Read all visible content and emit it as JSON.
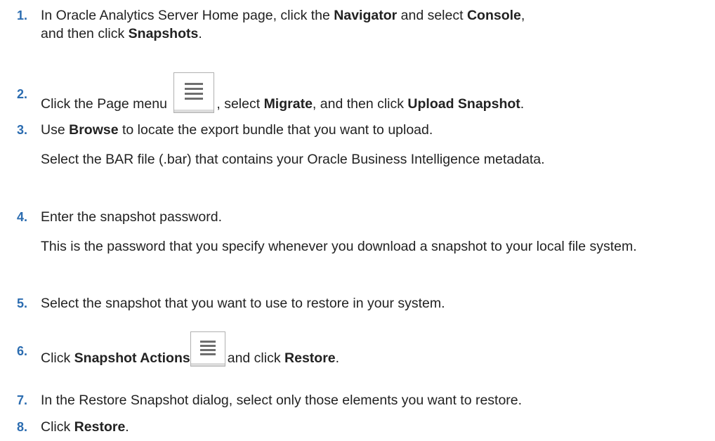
{
  "steps": [
    {
      "number": "1.",
      "p1": "In Oracle Analytics Server Home page, click the ",
      "b1": "Navigator",
      "p2": " and select ",
      "b2": "Console",
      "p3": ",",
      "p4": "and then click ",
      "b3": "Snapshots",
      "p5": "."
    },
    {
      "number": "2.",
      "p1": "Click the Page menu ",
      "icon": "page-menu-icon",
      "p2": ", select ",
      "b1": "Migrate",
      "p3": ", and then click ",
      "b2": "Upload Snapshot",
      "p4": "."
    },
    {
      "number": "3.",
      "p1": "Use ",
      "b1": "Browse",
      "p2": " to locate the export bundle that you want to upload.",
      "sub": "Select the BAR file (.bar) that contains your Oracle Business Intelligence metadata."
    },
    {
      "number": "4.",
      "p1": "Enter the snapshot password.",
      "sub": "This is the password that you specify whenever you download a snapshot to your local file system."
    },
    {
      "number": "5.",
      "p1": "Select the snapshot that you want to use to restore in your system."
    },
    {
      "number": "6.",
      "p1": "Click ",
      "b1": "Snapshot Actions",
      "icon": "snapshot-actions-menu-icon",
      "p2": "and click ",
      "b2": "Restore",
      "p3": "."
    },
    {
      "number": "7.",
      "p1": "In the Restore Snapshot dialog, select only those elements you want to restore."
    },
    {
      "number": "8.",
      "p1": "Click ",
      "b1": "Restore",
      "p2": "."
    }
  ],
  "colors": {
    "step_number": "#2b6cb0",
    "text": "#222222"
  }
}
